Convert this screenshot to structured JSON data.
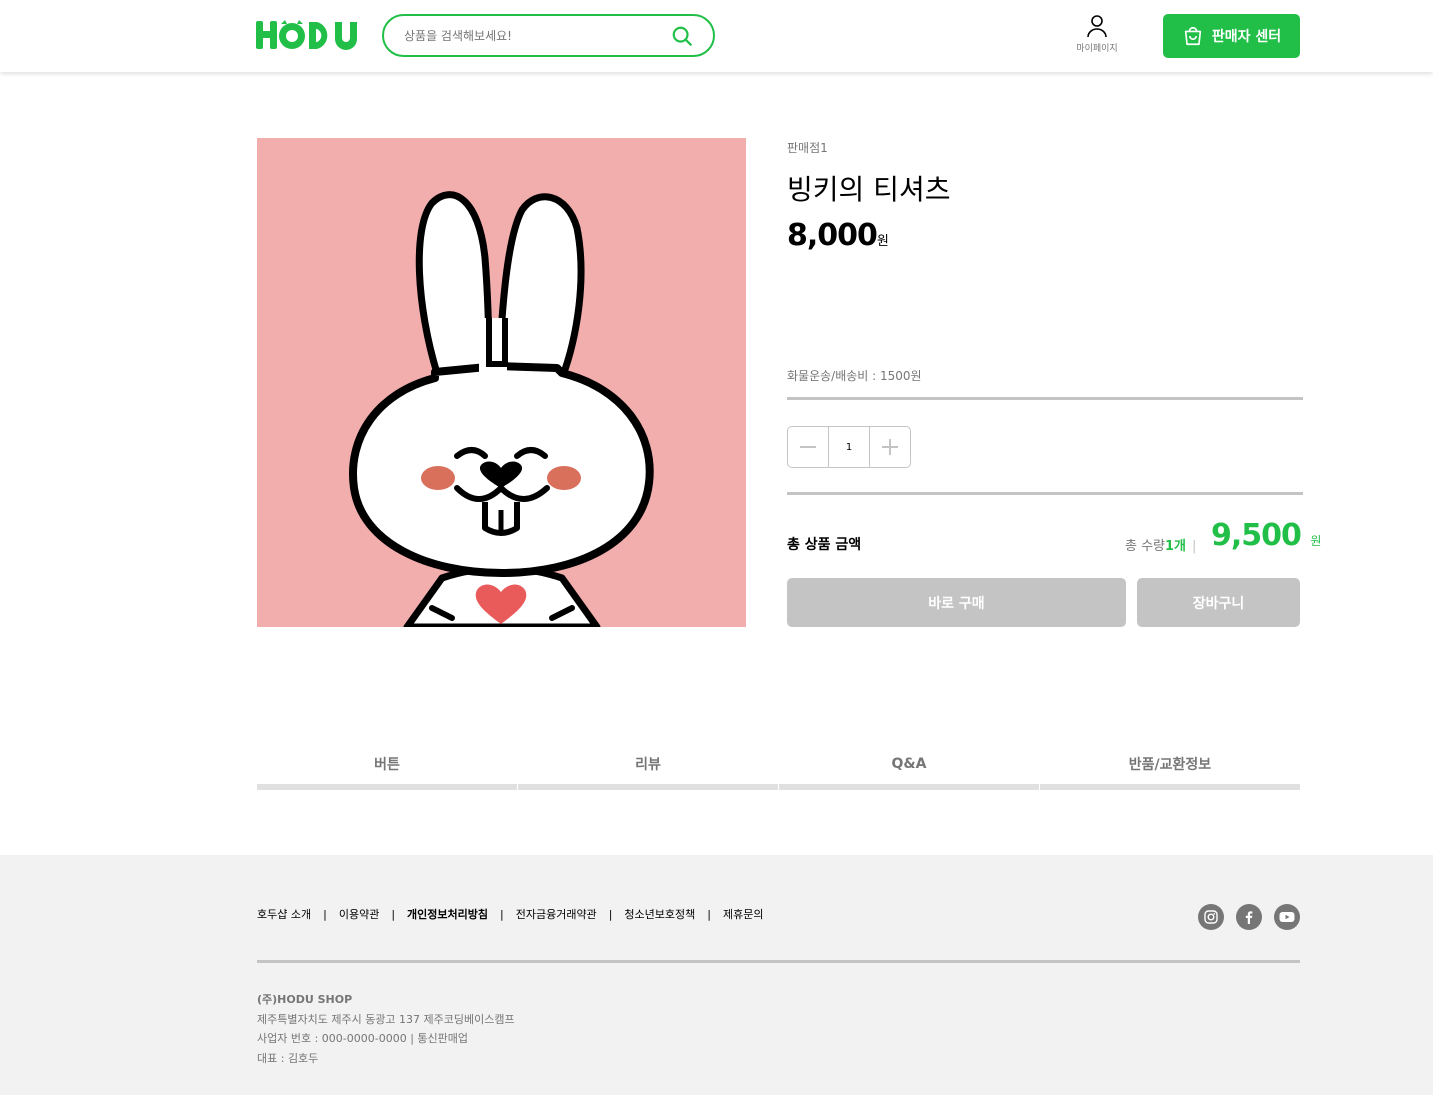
{
  "header": {
    "logo_text": "HODU",
    "search_placeholder": "상품을 검색해보세요!",
    "mypage_label": "마이페이지",
    "seller_center_label": "판매자 센터"
  },
  "product": {
    "store": "판매점1",
    "title": "빙키의 티셔츠",
    "price": "8,000",
    "price_unit": "원",
    "shipping": "화물운송/배송비 : 1500원",
    "quantity": "1",
    "total_label": "총 상품 금액",
    "total_qty_prefix": "총 수량",
    "total_qty_value": "1개",
    "total_price": "9,500",
    "total_price_unit": "원",
    "buy_label": "바로 구매",
    "cart_label": "장바구니",
    "image_bg": "#F2ADAD"
  },
  "tabs": [
    {
      "label": "버튼"
    },
    {
      "label": "리뷰"
    },
    {
      "label": "Q&A"
    },
    {
      "label": "반품/교환정보"
    }
  ],
  "footer": {
    "links": [
      {
        "label": "호두샵 소개"
      },
      {
        "label": "이용약관"
      },
      {
        "label": "개인정보처리방침"
      },
      {
        "label": "전자금융거래약관"
      },
      {
        "label": "청소년보호정책"
      },
      {
        "label": "제휴문의"
      }
    ],
    "sns": [
      "instagram-icon",
      "facebook-icon",
      "youtube-icon"
    ],
    "company_name": "(주)HODU SHOP",
    "address": "제주특별자치도 제주시 동광고 137 제주코딩베이스캠프",
    "business_number": "사업자 번호 : 000-0000-0000 | 통신판매업",
    "ceo": "대표 : 김호두"
  },
  "colors": {
    "accent": "#21BF48",
    "disabled": "#C4C4C4",
    "footer_bg": "#F2F2F2"
  }
}
